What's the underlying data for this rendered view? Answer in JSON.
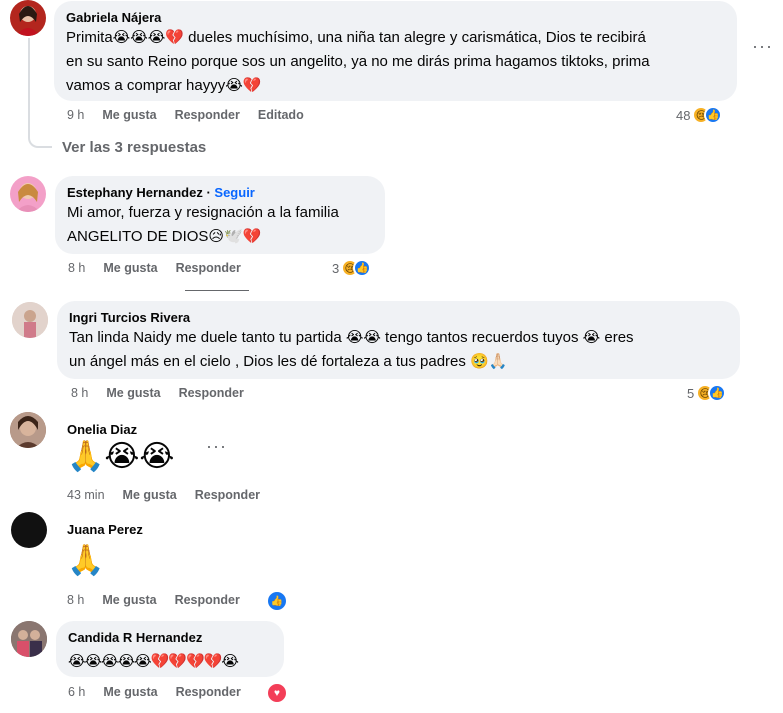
{
  "comments": [
    {
      "author": "Gabriela Nájera",
      "line1": "Primita😭😭😭💔 dueles muchísimo, una niña tan alegre y carismática, Dios te recibirá",
      "line2": "en su santo Reino porque sos un angelito, ya no me dirás prima hagamos tiktoks, prima",
      "line3": "vamos a comprar hayyy😭💔",
      "time": "9 h",
      "like": "Me gusta",
      "reply": "Responder",
      "edited": "Editado",
      "reactions": "48",
      "more_icon": "more-options-icon",
      "avatar_color": "#b3261e"
    },
    {
      "author": "Estephany Hernandez",
      "follow": "Seguir",
      "line1": "Mi amor, fuerza y resignación a la familia",
      "line2": "ANGELITO DE DIOS😥🕊️💔",
      "time": "8 h",
      "like": "Me gusta",
      "reply": "Responder",
      "reactions": "3",
      "avatar_color": "#f3a0c8"
    },
    {
      "author": "Ingri Turcios Rivera",
      "line1": "Tan linda Naidy me duele tanto tu partida 😭😭 tengo tantos recuerdos tuyos 😭 eres",
      "line2": "un ángel más en el cielo , Dios les dé fortaleza a tus padres 🥹🙏🏻",
      "time": "8 h",
      "like": "Me gusta",
      "reply": "Responder",
      "reactions": "5",
      "avatar_color": "#c9a7a0"
    },
    {
      "author": "Onelia Diaz",
      "emojis": "🙏😭😭",
      "time": "43 min",
      "like": "Me gusta",
      "reply": "Responder",
      "avatar_color": "#8a5a44"
    },
    {
      "author": "Juana Perez",
      "emojis": "🙏",
      "time": "8 h",
      "like": "Me gusta",
      "reply": "Responder",
      "avatar_color": "#111111"
    },
    {
      "author": "Candida R Hernandez",
      "emojis": "😭😭😭😭😭💔💔💔💔😭",
      "time": "6 h",
      "like": "Me gusta",
      "reply": "Responder",
      "avatar_color": "#6b5a5a"
    }
  ],
  "view_replies": "Ver las 3 respuestas",
  "colors": {
    "link": "#0866ff",
    "bubble": "#f0f2f5",
    "muted": "#65676b",
    "like": "#1877f2",
    "love": "#f33e58"
  }
}
